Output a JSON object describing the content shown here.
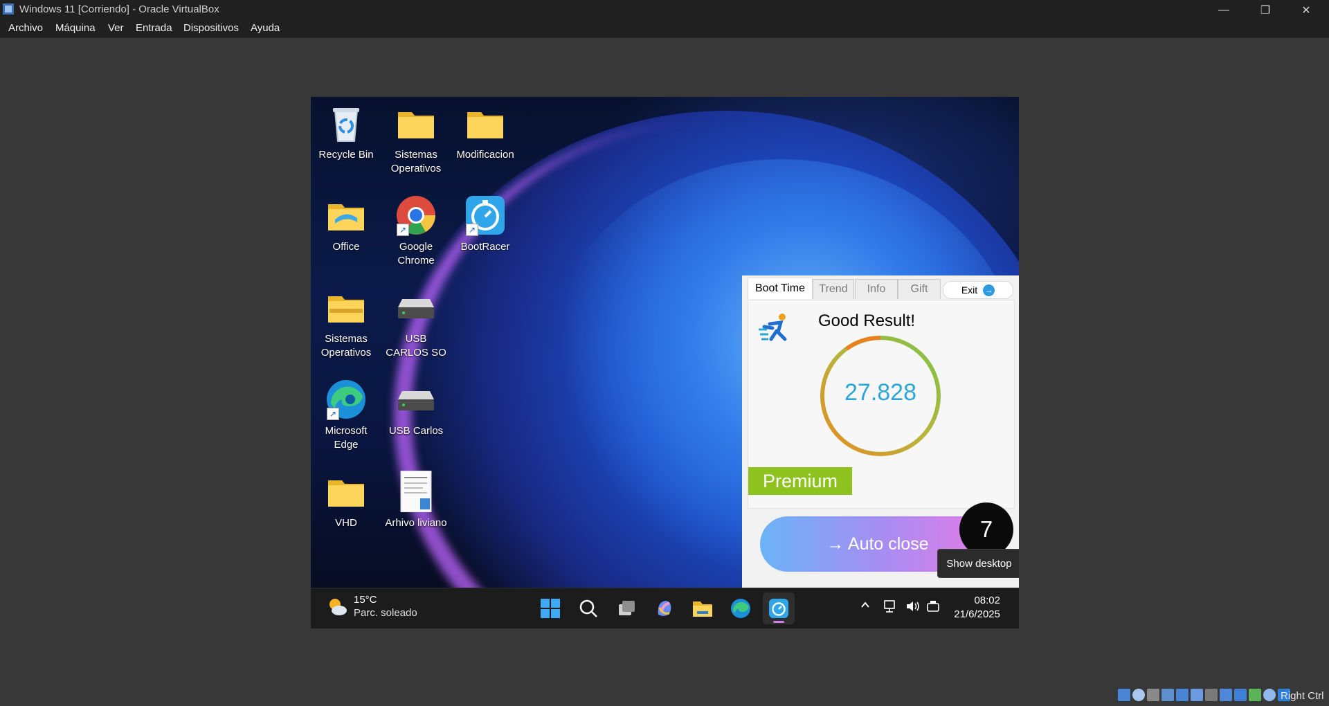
{
  "window": {
    "title": "Windows 11 [Corriendo] - Oracle VirtualBox",
    "controls": {
      "minimize": "—",
      "restore": "❐",
      "close": "✕"
    }
  },
  "menu": [
    "Archivo",
    "Máquina",
    "Ver",
    "Entrada",
    "Dispositivos",
    "Ayuda"
  ],
  "desktop_icons": [
    {
      "label": "Recycle Bin",
      "icon": "recycle-bin-icon"
    },
    {
      "label": "Sistemas Operativos",
      "icon": "folder-icon"
    },
    {
      "label": "Modificacion",
      "icon": "folder-icon"
    },
    {
      "label": "Office",
      "icon": "folder-icon"
    },
    {
      "label": "Google Chrome",
      "icon": "chrome-icon"
    },
    {
      "label": "BootRacer",
      "icon": "bootracer-icon"
    },
    {
      "label": "Sistemas Operativos",
      "icon": "zip-folder-icon"
    },
    {
      "label": "USB CARLOS SO",
      "icon": "drive-icon"
    },
    {
      "label": "Microsoft Edge",
      "icon": "edge-icon"
    },
    {
      "label": "USB Carlos",
      "icon": "drive-icon"
    },
    {
      "label": "VHD",
      "icon": "folder-icon"
    },
    {
      "label": "Arhivo liviano",
      "icon": "document-icon"
    }
  ],
  "bootracer": {
    "tabs": [
      "Boot Time",
      "Trend",
      "Info",
      "Gift"
    ],
    "active_tab": "Boot Time",
    "exit_label": "Exit",
    "result_text": "Good Result!",
    "boot_time": "27.828",
    "premium_label": "Premium",
    "auto_close_label": "→ Auto close",
    "countdown": "7",
    "colors": {
      "accent": "#2ba6d9",
      "premium": "#8dc21f"
    }
  },
  "tooltip": "Show desktop",
  "taskbar": {
    "weather_temp": "15°C",
    "weather_desc": "Parc. soleado",
    "time": "08:02",
    "date": "21/6/2025",
    "apps": [
      "start-icon",
      "search-icon",
      "task-view-icon",
      "copilot-icon",
      "file-explorer-icon",
      "edge-icon",
      "bootracer-icon"
    ]
  },
  "host_status": {
    "right_ctrl": "Right Ctrl"
  }
}
